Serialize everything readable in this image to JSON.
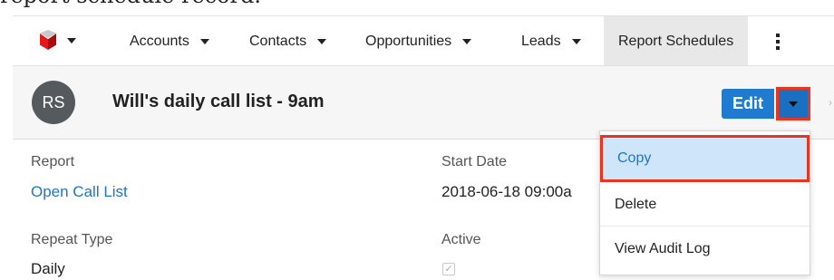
{
  "caption": "report schedule record.",
  "nav": {
    "items": [
      {
        "label": "Accounts",
        "has_caret": true
      },
      {
        "label": "Contacts",
        "has_caret": true
      },
      {
        "label": "Opportunities",
        "has_caret": true
      },
      {
        "label": "Leads",
        "has_caret": true
      },
      {
        "label": "Report Schedules",
        "active": true
      }
    ],
    "logo_icon": "sugar-cube-icon",
    "more_icon": "vertical-ellipsis-icon"
  },
  "record": {
    "avatar_initials": "RS",
    "title": "Will's daily call list - 9am",
    "edit_label": "Edit",
    "actions_icon": "chevron-down-icon",
    "close_icon": "close-icon"
  },
  "fields": {
    "report_label": "Report",
    "report_value": "Open Call List",
    "start_date_label": "Start Date",
    "start_date_value": "2018-06-18 09:00a",
    "repeat_type_label": "Repeat Type",
    "repeat_type_value": "Daily",
    "active_label": "Active",
    "active_checked": true
  },
  "menu": {
    "items": [
      {
        "label": "Copy",
        "highlighted": true
      },
      {
        "label": "Delete"
      },
      {
        "label": "View Audit Log"
      }
    ]
  },
  "colors": {
    "accent": "#1f7bd0",
    "highlight_border": "#e8351f",
    "highlight_fill": "#cfe6fa",
    "link": "#1f74c6"
  }
}
